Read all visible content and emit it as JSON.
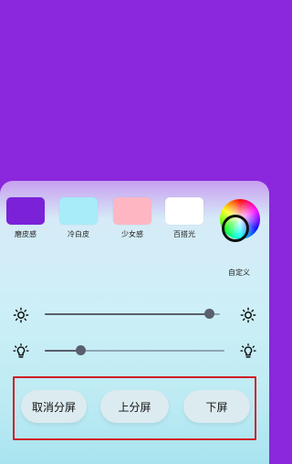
{
  "panel": {
    "presets": [
      {
        "label": "磨皮感",
        "color": "#7b22d8"
      },
      {
        "label": "冷白皮",
        "color": "#a7ecf8"
      },
      {
        "label": "少女感",
        "color": "#ffb6c3"
      },
      {
        "label": "百搭光",
        "color": "#ffffff"
      }
    ],
    "custom": {
      "label": "自定义",
      "icon": "color-wheel-icon"
    }
  },
  "sliders": {
    "brightness": {
      "icon": "sun-icon",
      "value": 0.94
    },
    "warmth": {
      "icon": "bulb-icon",
      "value": 0.2
    }
  },
  "buttons": {
    "cancel": "取消分屏",
    "up": "上分屏",
    "down": "下屏"
  },
  "colors": {
    "background": "#8b27dc",
    "highlight_frame": "#d11d25"
  }
}
